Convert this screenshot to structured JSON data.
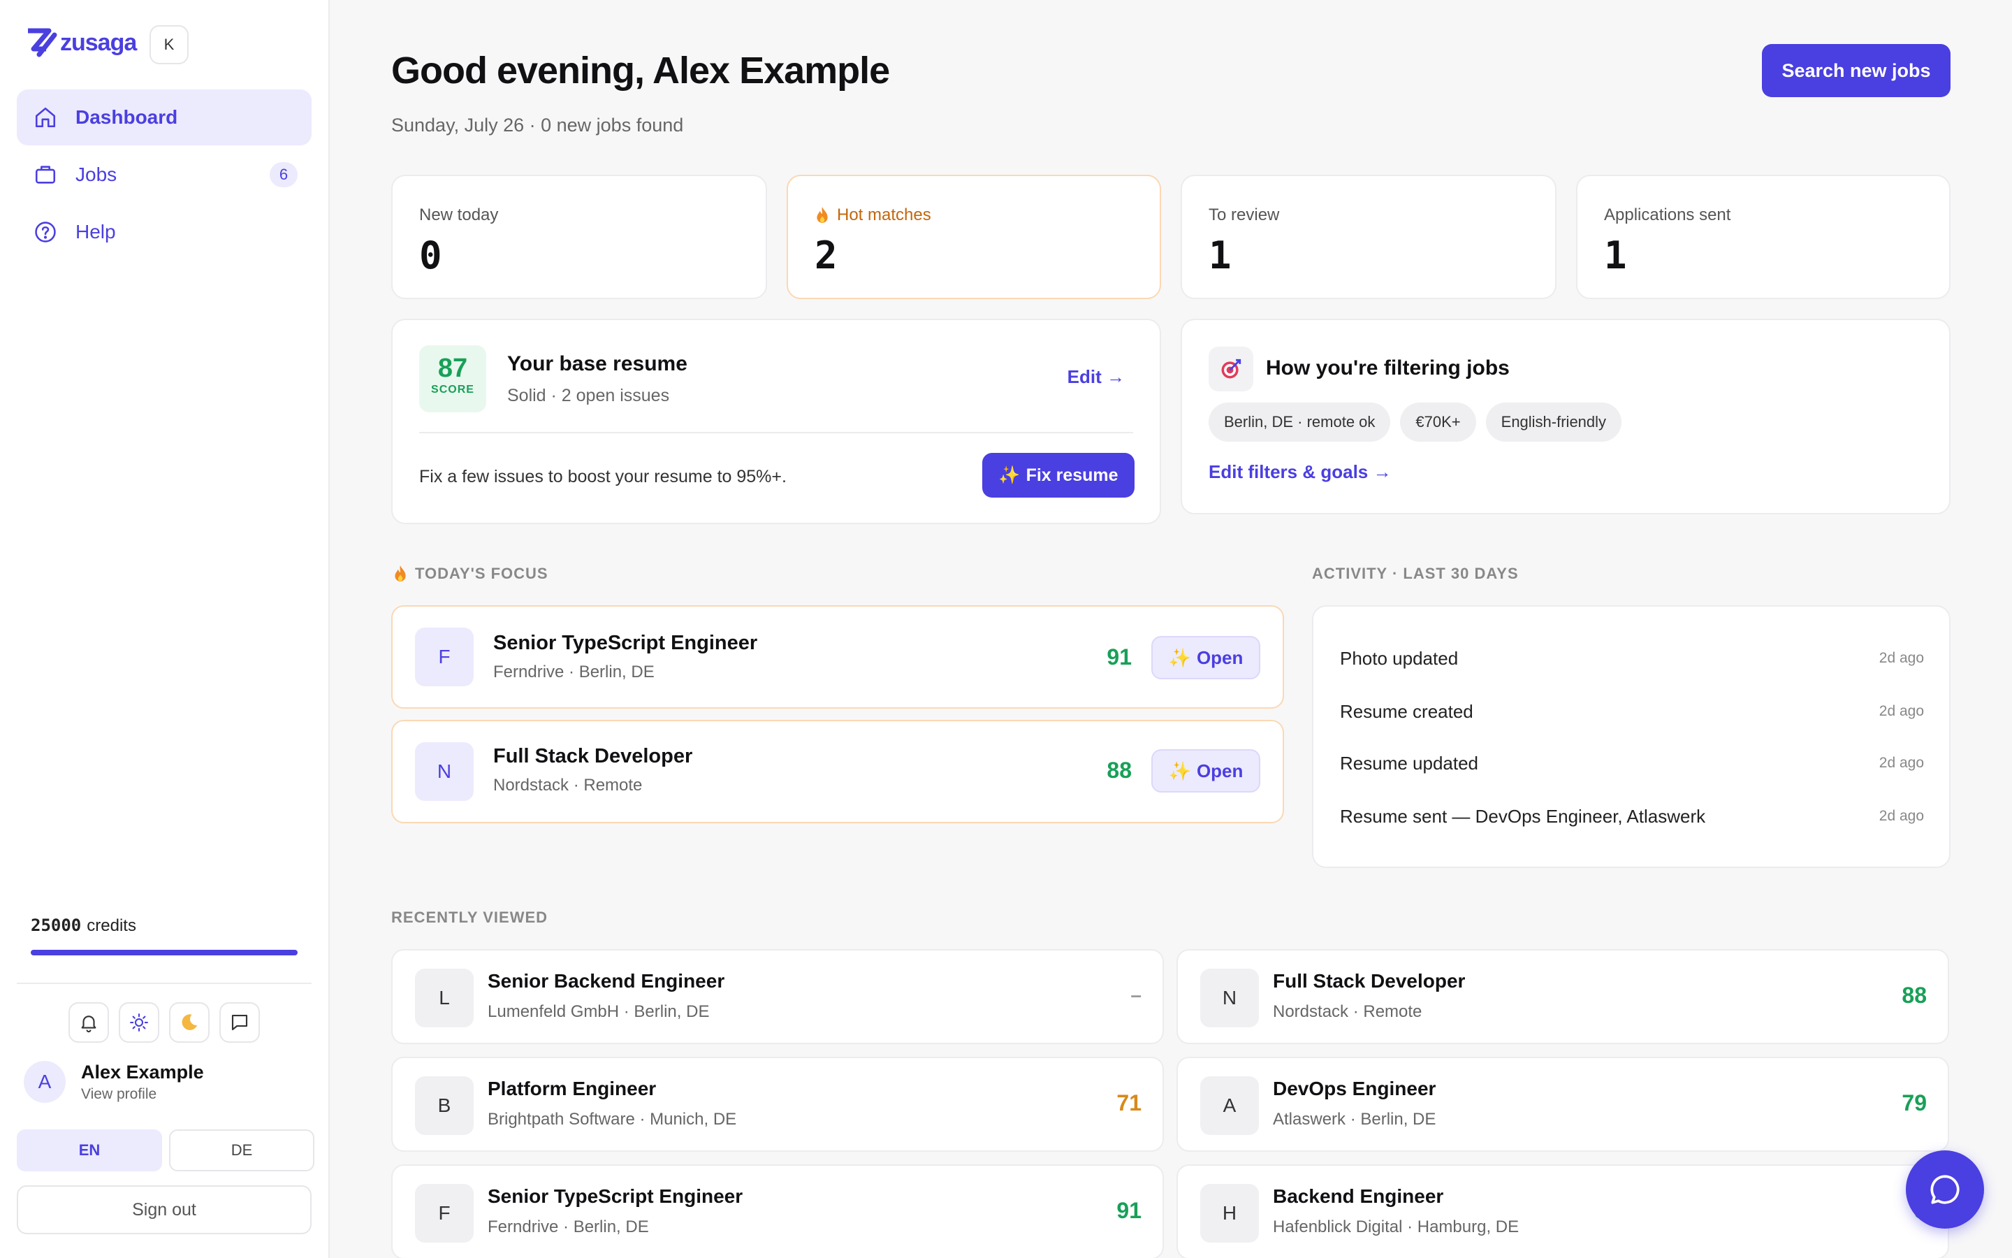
{
  "sidebar": {
    "brand": "zusaga",
    "kbd": "K",
    "nav": [
      {
        "label": "Dashboard",
        "icon": "home-icon"
      },
      {
        "label": "Jobs",
        "icon": "briefcase-icon",
        "badge": "6"
      },
      {
        "label": "Help",
        "icon": "help-circle-icon"
      }
    ],
    "credits": {
      "amount": "25000",
      "label": "credits",
      "fill_fraction": 1.0
    },
    "tools": [
      "bell-icon",
      "sun-icon",
      "moon-icon",
      "chat-icon"
    ],
    "user": {
      "initial": "A",
      "name": "Alex Example",
      "link": "View profile"
    },
    "lang": {
      "en": "EN",
      "de": "DE"
    },
    "signout": "Sign out"
  },
  "header": {
    "title": "Good evening, Alex Example",
    "subtitle": "Sunday, July 26 · 0 new jobs found",
    "cta": "Search new jobs"
  },
  "stats": [
    {
      "label": "New today",
      "value": "0"
    },
    {
      "label": "Hot matches",
      "value": "2"
    },
    {
      "label": "To review",
      "value": "1"
    },
    {
      "label": "Applications sent",
      "value": "1"
    }
  ],
  "resume": {
    "score": "87",
    "score_label": "SCORE",
    "title": "Your base resume",
    "status": "Solid · 2 open issues",
    "edit": "Edit →",
    "hint": "Fix a few issues to boost your resume to 95%+.",
    "fix": "Fix resume"
  },
  "filters": {
    "title": "How you're filtering jobs",
    "chips": [
      "Berlin, DE · remote ok",
      "€70K+",
      "English-friendly"
    ],
    "link": "Edit filters & goals →"
  },
  "focus": {
    "label": "TODAY'S FOCUS",
    "open": "Open",
    "items": [
      {
        "initial": "F",
        "title": "Senior TypeScript Engineer",
        "sub": "Ferndrive · Berlin, DE",
        "score": "91"
      },
      {
        "initial": "N",
        "title": "Full Stack Developer",
        "sub": "Nordstack · Remote",
        "score": "88"
      }
    ]
  },
  "activity": {
    "label": "ACTIVITY · LAST 30 DAYS",
    "items": [
      {
        "text": "Photo updated",
        "time": "2d ago"
      },
      {
        "text": "Resume created",
        "time": "2d ago"
      },
      {
        "text": "Resume updated",
        "time": "2d ago"
      },
      {
        "text": "Resume sent — DevOps Engineer, Atlaswerk",
        "time": "2d ago"
      }
    ]
  },
  "recent": {
    "label": "RECENTLY VIEWED",
    "items": [
      {
        "initial": "L",
        "title": "Senior Backend Engineer",
        "sub": "Lumenfeld GmbH · Berlin, DE",
        "score": "–"
      },
      {
        "initial": "N",
        "title": "Full Stack Developer",
        "sub": "Nordstack · Remote",
        "score": "88"
      },
      {
        "initial": "B",
        "title": "Platform Engineer",
        "sub": "Brightpath Software · Munich, DE",
        "score": "71"
      },
      {
        "initial": "A",
        "title": "DevOps Engineer",
        "sub": "Atlaswerk · Berlin, DE",
        "score": "79"
      },
      {
        "initial": "F",
        "title": "Senior TypeScript Engineer",
        "sub": "Ferndrive · Berlin, DE",
        "score": "91"
      },
      {
        "initial": "H",
        "title": "Backend Engineer",
        "sub": "Hafenblick Digital · Hamburg, DE",
        "score": "8"
      }
    ]
  },
  "colors": {
    "accent": "#4a3fe0",
    "good": "#18a058",
    "medium": "#d78a1a",
    "hot": "#c2670c"
  }
}
